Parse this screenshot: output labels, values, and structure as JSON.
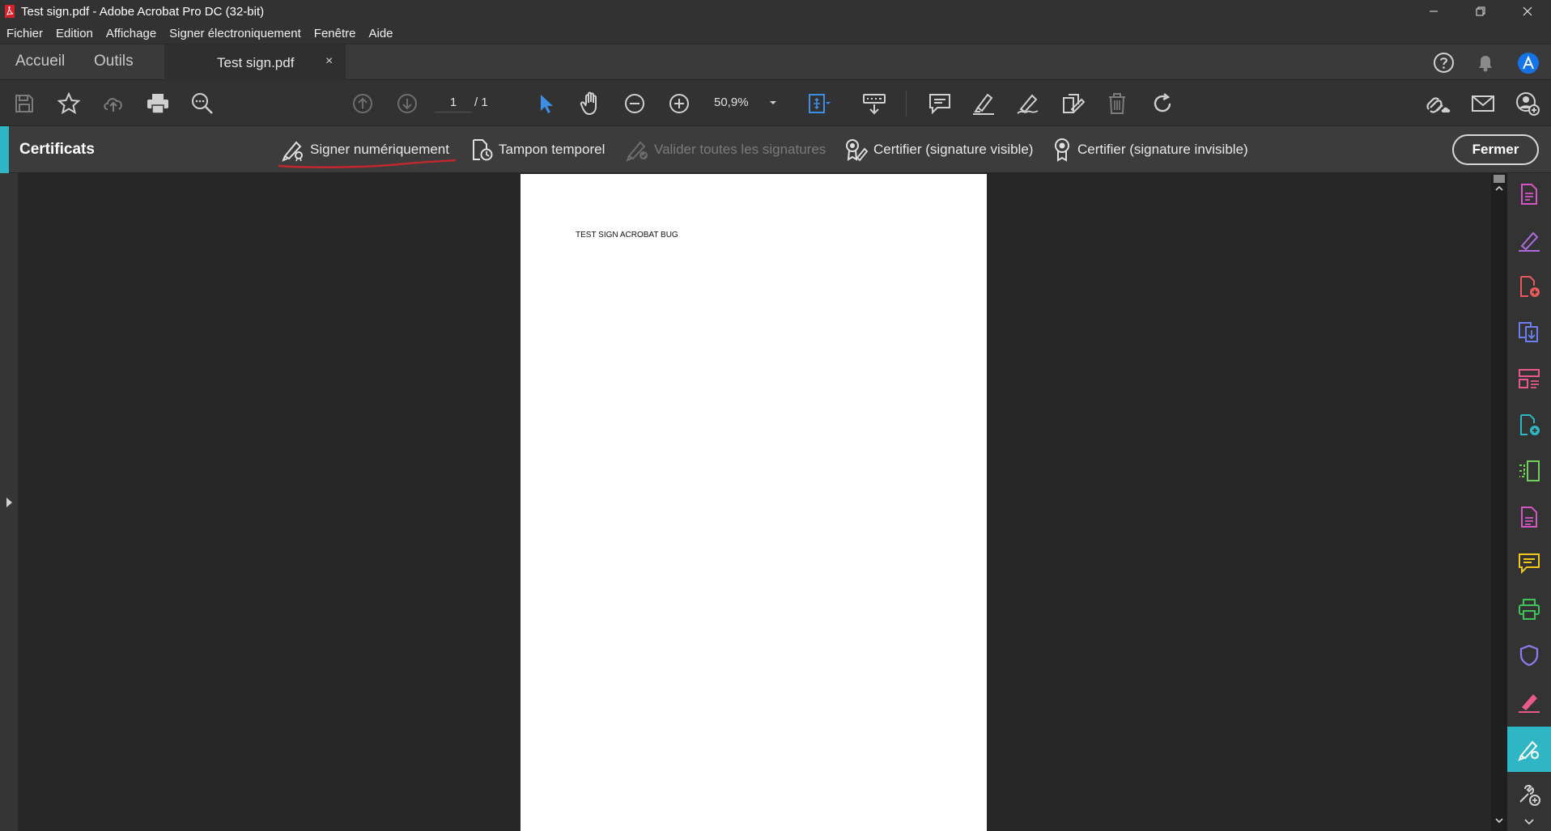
{
  "window": {
    "title": "Test sign.pdf - Adobe Acrobat Pro DC (32-bit)"
  },
  "menu": [
    "Fichier",
    "Edition",
    "Affichage",
    "Signer électroniquement",
    "Fenêtre",
    "Aide"
  ],
  "tabs": {
    "home": "Accueil",
    "tools": "Outils",
    "document": "Test sign.pdf",
    "close_glyph": "×"
  },
  "toolbar": {
    "page_current": "1",
    "page_total": "/ 1",
    "zoom": "50,9%"
  },
  "certificates": {
    "title": "Certificats",
    "tools": [
      {
        "label": "Signer numériquement",
        "enabled": true
      },
      {
        "label": "Tampon temporel",
        "enabled": true
      },
      {
        "label": "Valider toutes les signatures",
        "enabled": false
      },
      {
        "label": "Certifier (signature visible)",
        "enabled": true
      },
      {
        "label": "Certifier (signature invisible)",
        "enabled": true
      }
    ],
    "close_label": "Fermer"
  },
  "document": {
    "text": "TEST SIGN ACROBAT BUG"
  },
  "colors": {
    "accent": "#2fb6c4",
    "link_blue": "#3d8fe6",
    "annotation_red": "#c0282e"
  },
  "right_panel_icons": [
    "create-pdf-icon",
    "edit-pdf-icon",
    "export-pdf-icon",
    "combine-files-icon",
    "organize-pages-icon",
    "request-signature-icon",
    "scan-ocr-icon",
    "fill-sign-doc-icon",
    "comment-icon",
    "print-production-icon",
    "protect-icon",
    "fill-sign-icon",
    "certificates-icon",
    "more-tools-icon"
  ]
}
